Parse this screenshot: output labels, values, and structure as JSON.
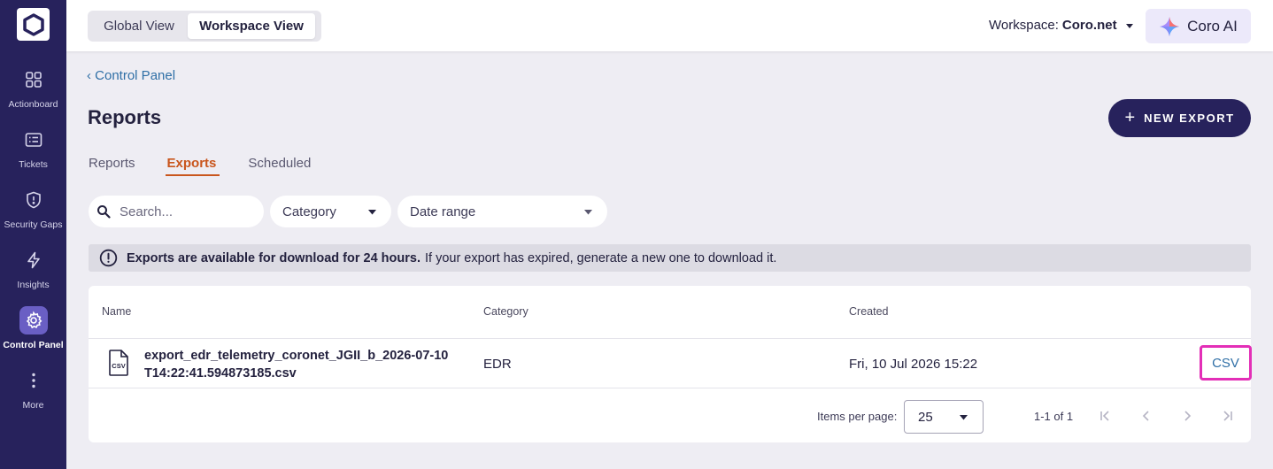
{
  "sidebar": {
    "items": [
      {
        "label": "Actionboard",
        "icon": "grid-icon"
      },
      {
        "label": "Tickets",
        "icon": "ticket-list-icon"
      },
      {
        "label": "Security Gaps",
        "icon": "shield-alert-icon"
      },
      {
        "label": "Insights",
        "icon": "lightning-icon"
      },
      {
        "label": "Control Panel",
        "icon": "gear-icon",
        "active": true
      },
      {
        "label": "More",
        "icon": "more-vertical-icon"
      }
    ]
  },
  "topbar": {
    "view_toggle": {
      "global": "Global View",
      "workspace": "Workspace View",
      "selected": "Workspace View"
    },
    "workspace_label": "Workspace:",
    "workspace_value": "Coro.net",
    "ai_button": "Coro AI"
  },
  "breadcrumb": "‹ Control Panel",
  "page_title": "Reports",
  "new_export_label": "NEW EXPORT",
  "tabs": [
    {
      "label": "Reports"
    },
    {
      "label": "Exports",
      "active": true
    },
    {
      "label": "Scheduled"
    }
  ],
  "filters": {
    "search_placeholder": "Search...",
    "category": "Category",
    "date_range": "Date range"
  },
  "banner": {
    "bold": "Exports are available for download for 24 hours.",
    "text": "If your export has expired, generate a new one to download it."
  },
  "table": {
    "columns": {
      "name": "Name",
      "category": "Category",
      "created": "Created"
    },
    "rows": [
      {
        "icon": "csv-file-icon",
        "file_type": "CSV",
        "name": "export_edr_telemetry_coronet_JGII_b_2026-07-10T14:22:41.594873185.csv",
        "category": "EDR",
        "created": "Fri, 10 Jul 2026 15:22",
        "action": "CSV"
      }
    ]
  },
  "pagination": {
    "items_per_page_label": "Items per page:",
    "items_per_page": "25",
    "range": "1-1 of 1"
  },
  "colors": {
    "sidebar_bg": "#27225c",
    "accent_tab": "#c9561d",
    "link": "#2f6fa6",
    "highlight": "#e32fb7"
  }
}
